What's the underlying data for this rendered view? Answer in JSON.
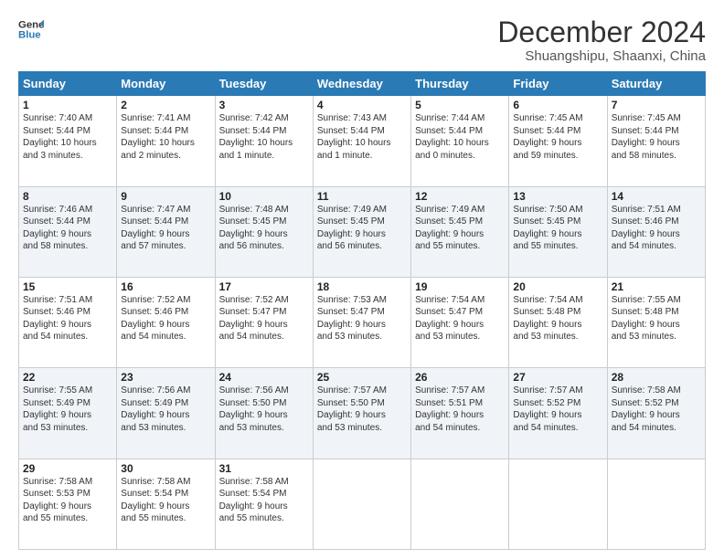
{
  "logo": {
    "line1": "General",
    "line2": "Blue"
  },
  "header": {
    "month": "December 2024",
    "location": "Shuangshipu, Shaanxi, China"
  },
  "weekdays": [
    "Sunday",
    "Monday",
    "Tuesday",
    "Wednesday",
    "Thursday",
    "Friday",
    "Saturday"
  ],
  "weeks": [
    [
      {
        "day": "1",
        "sunrise": "7:40 AM",
        "sunset": "5:44 PM",
        "daylight": "10 hours and 3 minutes."
      },
      {
        "day": "2",
        "sunrise": "7:41 AM",
        "sunset": "5:44 PM",
        "daylight": "10 hours and 2 minutes."
      },
      {
        "day": "3",
        "sunrise": "7:42 AM",
        "sunset": "5:44 PM",
        "daylight": "10 hours and 1 minute."
      },
      {
        "day": "4",
        "sunrise": "7:43 AM",
        "sunset": "5:44 PM",
        "daylight": "10 hours and 1 minute."
      },
      {
        "day": "5",
        "sunrise": "7:44 AM",
        "sunset": "5:44 PM",
        "daylight": "10 hours and 0 minutes."
      },
      {
        "day": "6",
        "sunrise": "7:45 AM",
        "sunset": "5:44 PM",
        "daylight": "9 hours and 59 minutes."
      },
      {
        "day": "7",
        "sunrise": "7:45 AM",
        "sunset": "5:44 PM",
        "daylight": "9 hours and 58 minutes."
      }
    ],
    [
      {
        "day": "8",
        "sunrise": "7:46 AM",
        "sunset": "5:44 PM",
        "daylight": "9 hours and 58 minutes."
      },
      {
        "day": "9",
        "sunrise": "7:47 AM",
        "sunset": "5:44 PM",
        "daylight": "9 hours and 57 minutes."
      },
      {
        "day": "10",
        "sunrise": "7:48 AM",
        "sunset": "5:45 PM",
        "daylight": "9 hours and 56 minutes."
      },
      {
        "day": "11",
        "sunrise": "7:49 AM",
        "sunset": "5:45 PM",
        "daylight": "9 hours and 56 minutes."
      },
      {
        "day": "12",
        "sunrise": "7:49 AM",
        "sunset": "5:45 PM",
        "daylight": "9 hours and 55 minutes."
      },
      {
        "day": "13",
        "sunrise": "7:50 AM",
        "sunset": "5:45 PM",
        "daylight": "9 hours and 55 minutes."
      },
      {
        "day": "14",
        "sunrise": "7:51 AM",
        "sunset": "5:46 PM",
        "daylight": "9 hours and 54 minutes."
      }
    ],
    [
      {
        "day": "15",
        "sunrise": "7:51 AM",
        "sunset": "5:46 PM",
        "daylight": "9 hours and 54 minutes."
      },
      {
        "day": "16",
        "sunrise": "7:52 AM",
        "sunset": "5:46 PM",
        "daylight": "9 hours and 54 minutes."
      },
      {
        "day": "17",
        "sunrise": "7:52 AM",
        "sunset": "5:47 PM",
        "daylight": "9 hours and 54 minutes."
      },
      {
        "day": "18",
        "sunrise": "7:53 AM",
        "sunset": "5:47 PM",
        "daylight": "9 hours and 53 minutes."
      },
      {
        "day": "19",
        "sunrise": "7:54 AM",
        "sunset": "5:47 PM",
        "daylight": "9 hours and 53 minutes."
      },
      {
        "day": "20",
        "sunrise": "7:54 AM",
        "sunset": "5:48 PM",
        "daylight": "9 hours and 53 minutes."
      },
      {
        "day": "21",
        "sunrise": "7:55 AM",
        "sunset": "5:48 PM",
        "daylight": "9 hours and 53 minutes."
      }
    ],
    [
      {
        "day": "22",
        "sunrise": "7:55 AM",
        "sunset": "5:49 PM",
        "daylight": "9 hours and 53 minutes."
      },
      {
        "day": "23",
        "sunrise": "7:56 AM",
        "sunset": "5:49 PM",
        "daylight": "9 hours and 53 minutes."
      },
      {
        "day": "24",
        "sunrise": "7:56 AM",
        "sunset": "5:50 PM",
        "daylight": "9 hours and 53 minutes."
      },
      {
        "day": "25",
        "sunrise": "7:57 AM",
        "sunset": "5:50 PM",
        "daylight": "9 hours and 53 minutes."
      },
      {
        "day": "26",
        "sunrise": "7:57 AM",
        "sunset": "5:51 PM",
        "daylight": "9 hours and 54 minutes."
      },
      {
        "day": "27",
        "sunrise": "7:57 AM",
        "sunset": "5:52 PM",
        "daylight": "9 hours and 54 minutes."
      },
      {
        "day": "28",
        "sunrise": "7:58 AM",
        "sunset": "5:52 PM",
        "daylight": "9 hours and 54 minutes."
      }
    ],
    [
      {
        "day": "29",
        "sunrise": "7:58 AM",
        "sunset": "5:53 PM",
        "daylight": "9 hours and 55 minutes."
      },
      {
        "day": "30",
        "sunrise": "7:58 AM",
        "sunset": "5:54 PM",
        "daylight": "9 hours and 55 minutes."
      },
      {
        "day": "31",
        "sunrise": "7:58 AM",
        "sunset": "5:54 PM",
        "daylight": "9 hours and 55 minutes."
      },
      null,
      null,
      null,
      null
    ]
  ]
}
